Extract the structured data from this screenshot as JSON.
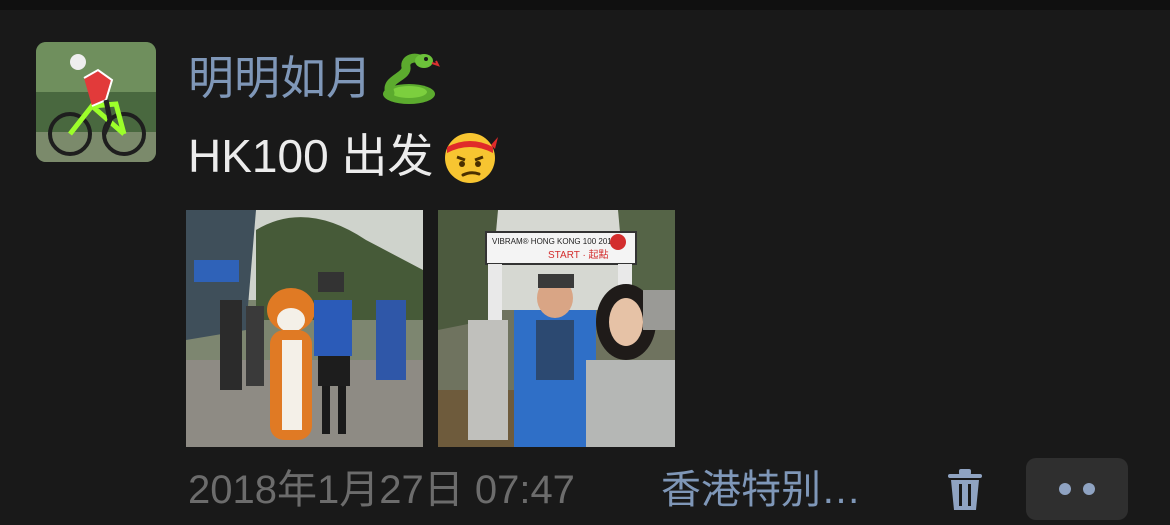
{
  "post": {
    "author_name": "明明如月",
    "author_emoji": "snake-emoji",
    "text": "HK100 出发",
    "text_emoji": "frowning-headband-emoji",
    "photos": [
      {
        "banner_top": "",
        "banner_main": ""
      },
      {
        "banner_top": "VIBRAM® HONG KONG 100 2018",
        "banner_main": "START · 起點"
      }
    ],
    "timestamp": "2018年1月27日 07:47",
    "location": "香港特别…"
  },
  "actions": {
    "delete_icon": "trash-icon",
    "more_icon": "more-dots-icon"
  },
  "colors": {
    "background": "#191919",
    "name_link": "#7f97b8",
    "text": "#ececec",
    "timestamp": "#6c6c6c"
  }
}
